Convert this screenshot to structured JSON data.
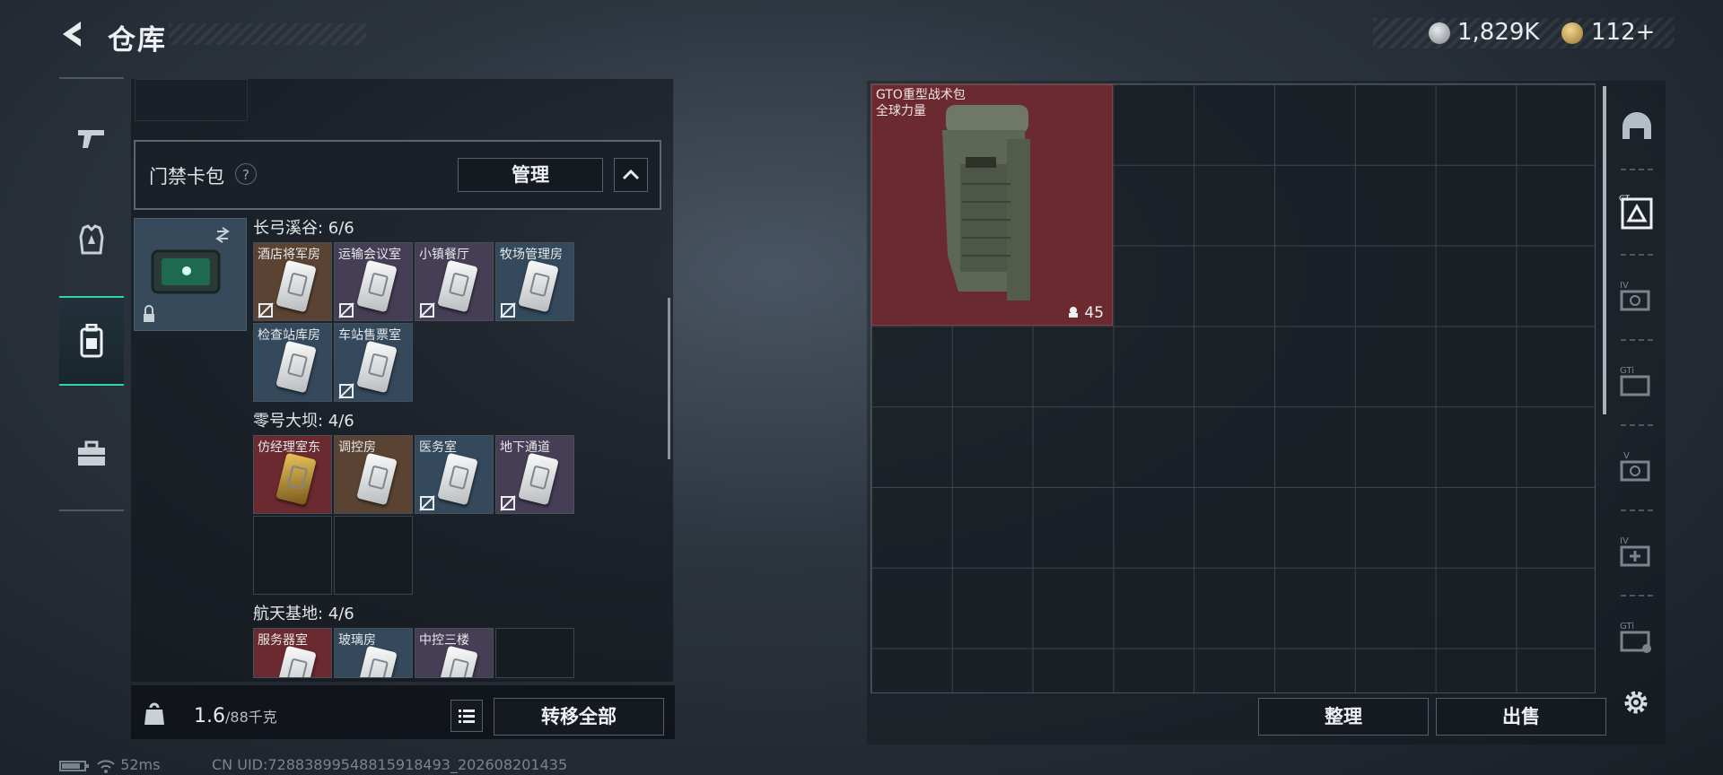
{
  "header": {
    "title": "仓库"
  },
  "currency": [
    {
      "icon": "silver-coin-icon",
      "value": "1,829K"
    },
    {
      "icon": "gold-coin-icon",
      "value": "112+"
    }
  ],
  "left_rail": [
    "gun-icon",
    "armor-icon",
    "backpack-icon",
    "briefcase-icon"
  ],
  "card_bag": {
    "label": "门禁卡包",
    "help": "?",
    "manage": "管理"
  },
  "sections": [
    {
      "title": "长弓溪谷: 6/6",
      "keys": [
        "酒店将军房",
        "运输会议室",
        "小镇餐厅",
        "牧场管理房",
        "检查站库房",
        "车站售票室"
      ]
    },
    {
      "title": "零号大坝: 4/6",
      "keys": [
        "仿经理室东",
        "调控房",
        "医务室",
        "地下通道"
      ]
    },
    {
      "title": "航天基地: 4/6",
      "keys": [
        "服务器室",
        "玻璃房",
        "中控三楼"
      ]
    }
  ],
  "bottom_bar": {
    "weight": "1.6",
    "capacity": "/88千克",
    "transfer_all": "转移全部"
  },
  "status": {
    "latency": "52ms",
    "uid": "CN UID:72883899548815918493_202608201435"
  },
  "stash": {
    "item_name": "GTO重型战术包",
    "item_sub": "全球力量",
    "item_count": "45",
    "sort": "整理",
    "sell": "出售"
  },
  "side_tabs": [
    "helmet-tab-icon",
    "gt-case-icon",
    "iv-case-icon",
    "gti-case-icon",
    "v-case-icon",
    "iv-plus-case-icon",
    "gti-case-2-icon"
  ],
  "colors": {
    "accent": "#2fd6a5",
    "item_bg_red": "#6a2a2f",
    "key_blue": "#34495b",
    "key_brown": "#5a4332",
    "key_red": "#6a2a2f",
    "key_purple": "#453e55"
  }
}
